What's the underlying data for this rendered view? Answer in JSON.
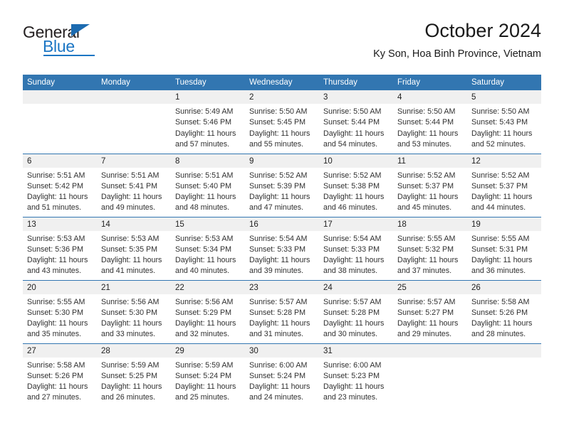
{
  "logo": {
    "word1": "General",
    "word2": "Blue",
    "accent_color": "#1c76c4"
  },
  "header": {
    "title": "October 2024",
    "subtitle": "Ky Son, Hoa Binh Province, Vietnam",
    "header_color": "#3276b1"
  },
  "calendar": {
    "weekday_headers": [
      "Sunday",
      "Monday",
      "Tuesday",
      "Wednesday",
      "Thursday",
      "Friday",
      "Saturday"
    ],
    "weeks": [
      [
        {
          "day": "",
          "empty": true
        },
        {
          "day": "",
          "empty": true
        },
        {
          "day": "1",
          "sunrise": "Sunrise: 5:49 AM",
          "sunset": "Sunset: 5:46 PM",
          "daylight1": "Daylight: 11 hours",
          "daylight2": "and 57 minutes."
        },
        {
          "day": "2",
          "sunrise": "Sunrise: 5:50 AM",
          "sunset": "Sunset: 5:45 PM",
          "daylight1": "Daylight: 11 hours",
          "daylight2": "and 55 minutes."
        },
        {
          "day": "3",
          "sunrise": "Sunrise: 5:50 AM",
          "sunset": "Sunset: 5:44 PM",
          "daylight1": "Daylight: 11 hours",
          "daylight2": "and 54 minutes."
        },
        {
          "day": "4",
          "sunrise": "Sunrise: 5:50 AM",
          "sunset": "Sunset: 5:44 PM",
          "daylight1": "Daylight: 11 hours",
          "daylight2": "and 53 minutes."
        },
        {
          "day": "5",
          "sunrise": "Sunrise: 5:50 AM",
          "sunset": "Sunset: 5:43 PM",
          "daylight1": "Daylight: 11 hours",
          "daylight2": "and 52 minutes."
        }
      ],
      [
        {
          "day": "6",
          "sunrise": "Sunrise: 5:51 AM",
          "sunset": "Sunset: 5:42 PM",
          "daylight1": "Daylight: 11 hours",
          "daylight2": "and 51 minutes."
        },
        {
          "day": "7",
          "sunrise": "Sunrise: 5:51 AM",
          "sunset": "Sunset: 5:41 PM",
          "daylight1": "Daylight: 11 hours",
          "daylight2": "and 49 minutes."
        },
        {
          "day": "8",
          "sunrise": "Sunrise: 5:51 AM",
          "sunset": "Sunset: 5:40 PM",
          "daylight1": "Daylight: 11 hours",
          "daylight2": "and 48 minutes."
        },
        {
          "day": "9",
          "sunrise": "Sunrise: 5:52 AM",
          "sunset": "Sunset: 5:39 PM",
          "daylight1": "Daylight: 11 hours",
          "daylight2": "and 47 minutes."
        },
        {
          "day": "10",
          "sunrise": "Sunrise: 5:52 AM",
          "sunset": "Sunset: 5:38 PM",
          "daylight1": "Daylight: 11 hours",
          "daylight2": "and 46 minutes."
        },
        {
          "day": "11",
          "sunrise": "Sunrise: 5:52 AM",
          "sunset": "Sunset: 5:37 PM",
          "daylight1": "Daylight: 11 hours",
          "daylight2": "and 45 minutes."
        },
        {
          "day": "12",
          "sunrise": "Sunrise: 5:52 AM",
          "sunset": "Sunset: 5:37 PM",
          "daylight1": "Daylight: 11 hours",
          "daylight2": "and 44 minutes."
        }
      ],
      [
        {
          "day": "13",
          "sunrise": "Sunrise: 5:53 AM",
          "sunset": "Sunset: 5:36 PM",
          "daylight1": "Daylight: 11 hours",
          "daylight2": "and 43 minutes."
        },
        {
          "day": "14",
          "sunrise": "Sunrise: 5:53 AM",
          "sunset": "Sunset: 5:35 PM",
          "daylight1": "Daylight: 11 hours",
          "daylight2": "and 41 minutes."
        },
        {
          "day": "15",
          "sunrise": "Sunrise: 5:53 AM",
          "sunset": "Sunset: 5:34 PM",
          "daylight1": "Daylight: 11 hours",
          "daylight2": "and 40 minutes."
        },
        {
          "day": "16",
          "sunrise": "Sunrise: 5:54 AM",
          "sunset": "Sunset: 5:33 PM",
          "daylight1": "Daylight: 11 hours",
          "daylight2": "and 39 minutes."
        },
        {
          "day": "17",
          "sunrise": "Sunrise: 5:54 AM",
          "sunset": "Sunset: 5:33 PM",
          "daylight1": "Daylight: 11 hours",
          "daylight2": "and 38 minutes."
        },
        {
          "day": "18",
          "sunrise": "Sunrise: 5:55 AM",
          "sunset": "Sunset: 5:32 PM",
          "daylight1": "Daylight: 11 hours",
          "daylight2": "and 37 minutes."
        },
        {
          "day": "19",
          "sunrise": "Sunrise: 5:55 AM",
          "sunset": "Sunset: 5:31 PM",
          "daylight1": "Daylight: 11 hours",
          "daylight2": "and 36 minutes."
        }
      ],
      [
        {
          "day": "20",
          "sunrise": "Sunrise: 5:55 AM",
          "sunset": "Sunset: 5:30 PM",
          "daylight1": "Daylight: 11 hours",
          "daylight2": "and 35 minutes."
        },
        {
          "day": "21",
          "sunrise": "Sunrise: 5:56 AM",
          "sunset": "Sunset: 5:30 PM",
          "daylight1": "Daylight: 11 hours",
          "daylight2": "and 33 minutes."
        },
        {
          "day": "22",
          "sunrise": "Sunrise: 5:56 AM",
          "sunset": "Sunset: 5:29 PM",
          "daylight1": "Daylight: 11 hours",
          "daylight2": "and 32 minutes."
        },
        {
          "day": "23",
          "sunrise": "Sunrise: 5:57 AM",
          "sunset": "Sunset: 5:28 PM",
          "daylight1": "Daylight: 11 hours",
          "daylight2": "and 31 minutes."
        },
        {
          "day": "24",
          "sunrise": "Sunrise: 5:57 AM",
          "sunset": "Sunset: 5:28 PM",
          "daylight1": "Daylight: 11 hours",
          "daylight2": "and 30 minutes."
        },
        {
          "day": "25",
          "sunrise": "Sunrise: 5:57 AM",
          "sunset": "Sunset: 5:27 PM",
          "daylight1": "Daylight: 11 hours",
          "daylight2": "and 29 minutes."
        },
        {
          "day": "26",
          "sunrise": "Sunrise: 5:58 AM",
          "sunset": "Sunset: 5:26 PM",
          "daylight1": "Daylight: 11 hours",
          "daylight2": "and 28 minutes."
        }
      ],
      [
        {
          "day": "27",
          "sunrise": "Sunrise: 5:58 AM",
          "sunset": "Sunset: 5:26 PM",
          "daylight1": "Daylight: 11 hours",
          "daylight2": "and 27 minutes."
        },
        {
          "day": "28",
          "sunrise": "Sunrise: 5:59 AM",
          "sunset": "Sunset: 5:25 PM",
          "daylight1": "Daylight: 11 hours",
          "daylight2": "and 26 minutes."
        },
        {
          "day": "29",
          "sunrise": "Sunrise: 5:59 AM",
          "sunset": "Sunset: 5:24 PM",
          "daylight1": "Daylight: 11 hours",
          "daylight2": "and 25 minutes."
        },
        {
          "day": "30",
          "sunrise": "Sunrise: 6:00 AM",
          "sunset": "Sunset: 5:24 PM",
          "daylight1": "Daylight: 11 hours",
          "daylight2": "and 24 minutes."
        },
        {
          "day": "31",
          "sunrise": "Sunrise: 6:00 AM",
          "sunset": "Sunset: 5:23 PM",
          "daylight1": "Daylight: 11 hours",
          "daylight2": "and 23 minutes."
        },
        {
          "day": "",
          "empty": true
        },
        {
          "day": "",
          "empty": true
        }
      ]
    ]
  }
}
